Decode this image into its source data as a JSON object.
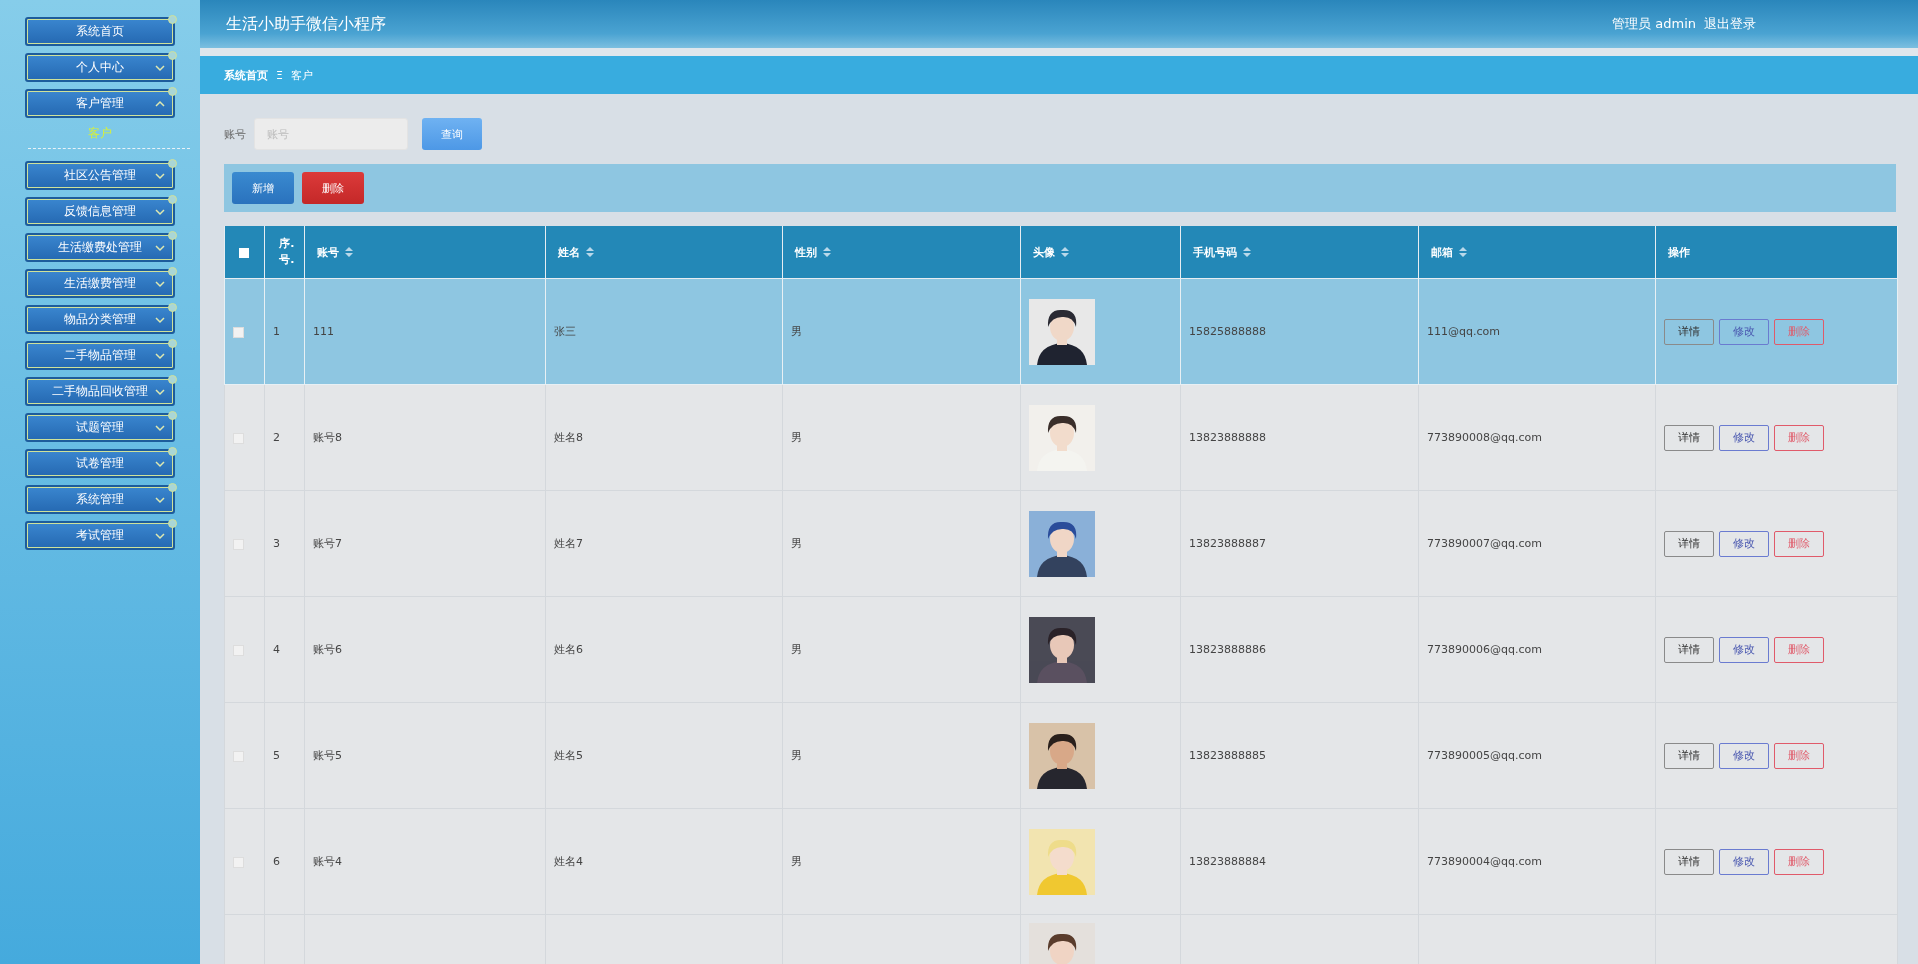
{
  "sidebar": {
    "items": [
      {
        "label": "系统首页",
        "kind": "link"
      },
      {
        "label": "个人中心",
        "kind": "menu",
        "expanded": false
      },
      {
        "label": "客户管理",
        "kind": "menu",
        "expanded": true,
        "children": [
          {
            "label": "客户",
            "selected": true
          }
        ]
      },
      {
        "label": "社区公告管理",
        "kind": "menu",
        "expanded": false
      },
      {
        "label": "反馈信息管理",
        "kind": "menu",
        "expanded": false
      },
      {
        "label": "生活缴费处管理",
        "kind": "menu",
        "expanded": false
      },
      {
        "label": "生活缴费管理",
        "kind": "menu",
        "expanded": false
      },
      {
        "label": "物品分类管理",
        "kind": "menu",
        "expanded": false
      },
      {
        "label": "二手物品管理",
        "kind": "menu",
        "expanded": false
      },
      {
        "label": "二手物品回收管理",
        "kind": "menu",
        "expanded": false
      },
      {
        "label": "试题管理",
        "kind": "menu",
        "expanded": false
      },
      {
        "label": "试卷管理",
        "kind": "menu",
        "expanded": false
      },
      {
        "label": "系统管理",
        "kind": "menu",
        "expanded": false
      },
      {
        "label": "考试管理",
        "kind": "menu",
        "expanded": false
      }
    ]
  },
  "header": {
    "title": "生活小助手微信小程序",
    "user": "管理员 admin",
    "logout": "退出登录"
  },
  "breadcrumb": {
    "items": [
      "系统首页",
      "客户"
    ],
    "separator": "Ξ"
  },
  "search": {
    "label": "账号",
    "placeholder": "账号",
    "button": "查询"
  },
  "toolbar": {
    "buttons": [
      {
        "label": "新增",
        "kind": "primary"
      },
      {
        "label": "删除",
        "kind": "danger"
      }
    ]
  },
  "table": {
    "select_all": {
      "checked": false
    },
    "columns": [
      {
        "label": "序.号.",
        "sortable": false
      },
      {
        "label": "账号",
        "sortable": true
      },
      {
        "label": "姓名",
        "sortable": true
      },
      {
        "label": "性别",
        "sortable": true
      },
      {
        "label": "头像",
        "sortable": true
      },
      {
        "label": "手机号码",
        "sortable": true
      },
      {
        "label": "邮箱",
        "sortable": true
      },
      {
        "label": "操作",
        "sortable": false
      }
    ],
    "rows": [
      {
        "selected": true,
        "checked": false,
        "index": "1",
        "account": "111",
        "name": "张三",
        "gender": "男",
        "phone": "15825888888",
        "email": "111@qq.com",
        "actions": [
          "详情",
          "修改",
          "删除"
        ]
      },
      {
        "selected": false,
        "checked": false,
        "index": "2",
        "account": "账号8",
        "name": "姓名8",
        "gender": "男",
        "phone": "13823888888",
        "email": "773890008@qq.com",
        "actions": [
          "详情",
          "修改",
          "删除"
        ]
      },
      {
        "selected": false,
        "checked": false,
        "index": "3",
        "account": "账号7",
        "name": "姓名7",
        "gender": "男",
        "phone": "13823888887",
        "email": "773890007@qq.com",
        "actions": [
          "详情",
          "修改",
          "删除"
        ]
      },
      {
        "selected": false,
        "checked": false,
        "index": "4",
        "account": "账号6",
        "name": "姓名6",
        "gender": "男",
        "phone": "13823888886",
        "email": "773890006@qq.com",
        "actions": [
          "详情",
          "修改",
          "删除"
        ]
      },
      {
        "selected": false,
        "checked": false,
        "index": "5",
        "account": "账号5",
        "name": "姓名5",
        "gender": "男",
        "phone": "13823888885",
        "email": "773890005@qq.com",
        "actions": [
          "详情",
          "修改",
          "删除"
        ]
      },
      {
        "selected": false,
        "checked": false,
        "index": "6",
        "account": "账号4",
        "name": "姓名4",
        "gender": "男",
        "phone": "13823888884",
        "email": "773890004@qq.com",
        "actions": [
          "详情",
          "修改",
          "删除"
        ]
      }
    ]
  }
}
